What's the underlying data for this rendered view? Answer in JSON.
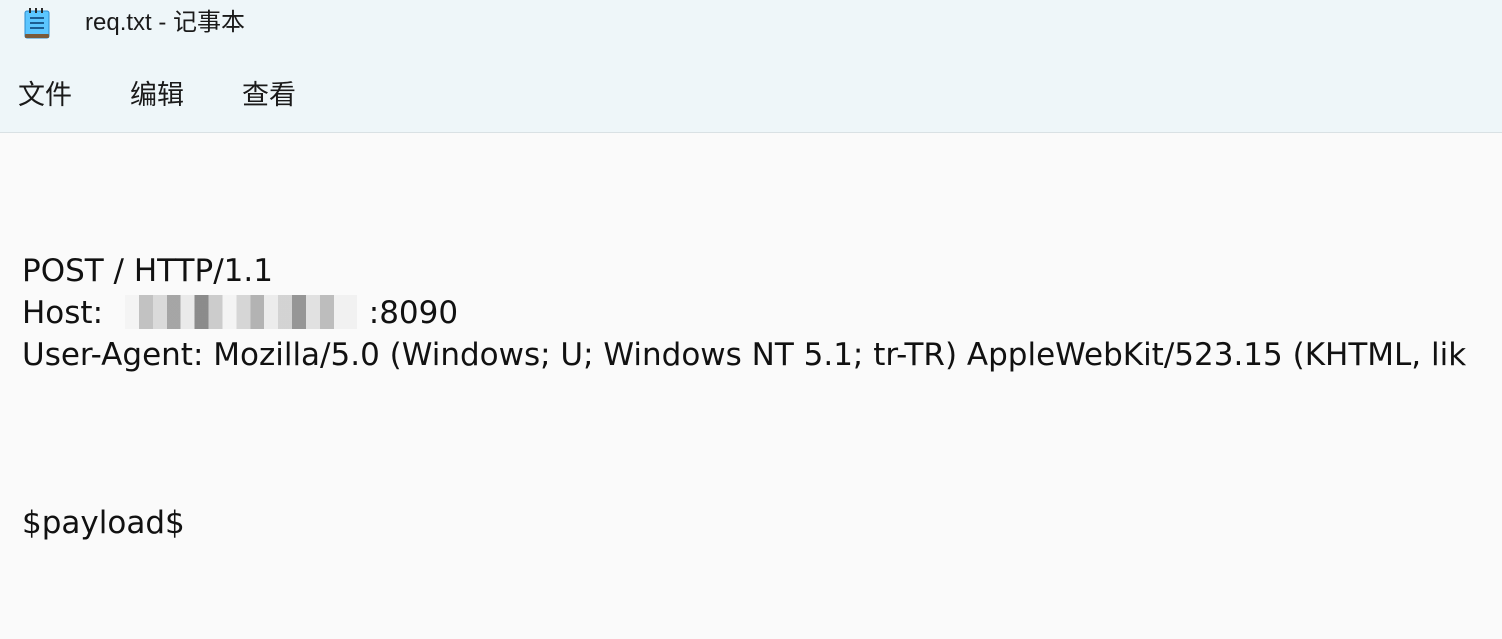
{
  "window": {
    "title": "req.txt - 记事本",
    "icon": "notepad-icon"
  },
  "menu": {
    "items": [
      "文件",
      "编辑",
      "查看"
    ]
  },
  "document": {
    "lines": [
      "POST / HTTP/1.1",
      "Host: ",
      ":8090",
      "User-Agent: Mozilla/5.0 (Windows; U; Windows NT 5.1; tr-TR) AppleWebKit/523.15 (KHTML, lik",
      "$payload$"
    ]
  },
  "colors": {
    "titlebar_bg": "#eef6f9",
    "editor_bg": "#fafafa",
    "text": "#111111"
  }
}
